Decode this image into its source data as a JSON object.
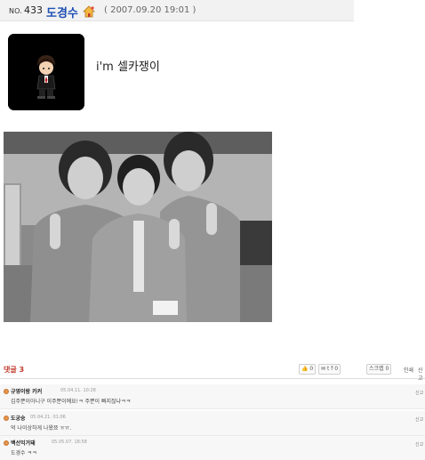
{
  "header": {
    "no_prefix": "NO.",
    "no_number": "433",
    "author": "도경수",
    "home_icon": "home-icon",
    "date": "( 2007.09.20 19:01 )"
  },
  "post": {
    "status_text": "i'm 셀카쟁이"
  },
  "comments_bar": {
    "title": "댓글 3",
    "like_count": "0",
    "share_count": "0",
    "scrap_label": "스크랩",
    "scrap_count": "0",
    "print_label": "인쇄",
    "report_label": "신고"
  },
  "comments": [
    {
      "author": "규영이랑 카커",
      "date": "05.04.11. 10:28",
      "text": "김주뿐이아니구 이주뿐이예요!ㅋ 주뿐이 빠지잖냐ㅋㅋ",
      "report": "신고"
    },
    {
      "author": "도궁숭",
      "date": "05.04.21. 01:06",
      "text": "억 나이상하게 나왔쬬 ㅠㅠ.",
      "report": "신고"
    },
    {
      "author": "백선익거돼",
      "date": "05.05.07. 18:58",
      "text": "도경수 ㅋㅋ",
      "report": "신고"
    }
  ],
  "colors": {
    "author_link": "#1f4fb3",
    "comment_title": "#c0392b",
    "header_bg": "#f2f2f2"
  }
}
